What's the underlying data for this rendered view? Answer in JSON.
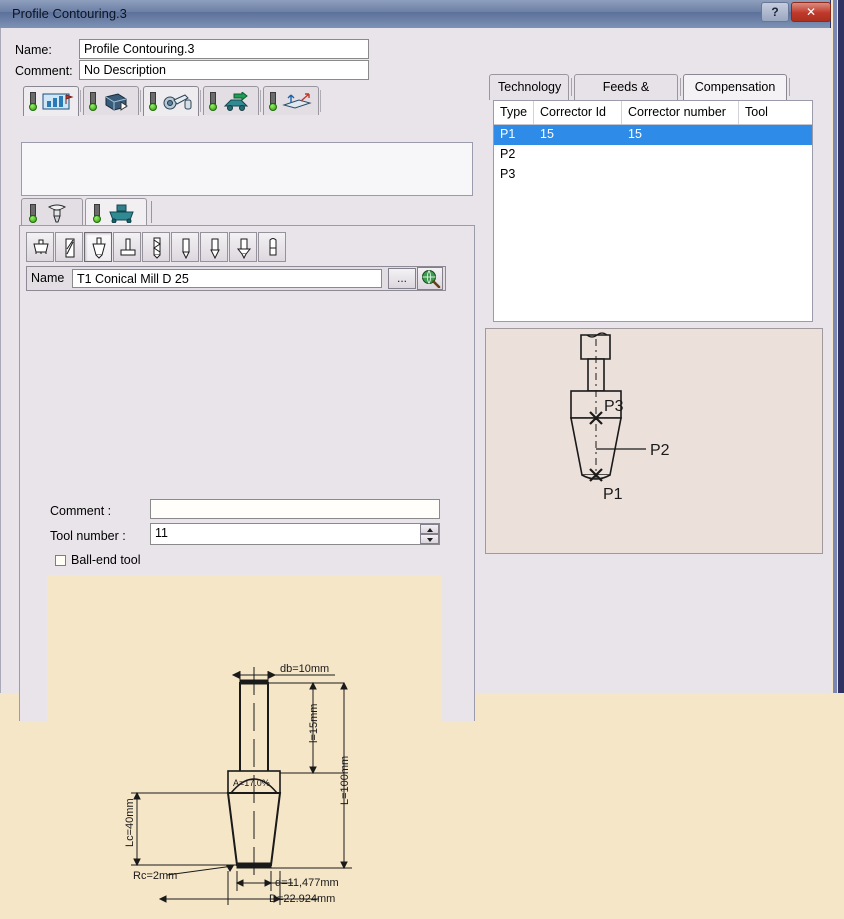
{
  "window": {
    "title": "Profile Contouring.3",
    "help_label": "?",
    "close_label": "✕"
  },
  "header": {
    "name_label": "Name:",
    "name_value": "Profile Contouring.3",
    "comment_label": "Comment:",
    "comment_value": "No Description"
  },
  "strategy_tabs": [
    {
      "name": "strategy",
      "icon": "strategy-icon",
      "selected": false
    },
    {
      "name": "geometry",
      "icon": "geometry-icon",
      "selected": false
    },
    {
      "name": "tool",
      "icon": "tool-icon",
      "selected": true
    },
    {
      "name": "feeds-speeds",
      "icon": "feeds-speeds-icon",
      "selected": false
    },
    {
      "name": "macros",
      "icon": "macros-icon",
      "selected": false
    }
  ],
  "sub_tabs": [
    {
      "name": "tool-definition",
      "icon": "tool-bit-icon",
      "selected": false
    },
    {
      "name": "tool-assembly",
      "icon": "tool-holder-icon",
      "selected": true
    }
  ],
  "tool_shapes": [
    {
      "name": "face-mill",
      "selected": false
    },
    {
      "name": "end-mill",
      "selected": false
    },
    {
      "name": "conical-mill",
      "selected": true
    },
    {
      "name": "t-slotter",
      "selected": false
    },
    {
      "name": "drill",
      "selected": false
    },
    {
      "name": "center-drill",
      "selected": false
    },
    {
      "name": "chamfer-tool",
      "selected": false
    },
    {
      "name": "countersink",
      "selected": false
    },
    {
      "name": "boring-bar",
      "selected": false
    }
  ],
  "tool_form": {
    "name_label": "Name",
    "name_value": "T1 Conical Mill D 25",
    "dots_label": "...",
    "browse_icon": "search-globe-icon",
    "comment_label": "Comment :",
    "comment_value": "",
    "comment_placeholder": "",
    "tool_number_label": "Tool number :",
    "tool_number_value": "11",
    "ball_end_label": "Ball-end tool",
    "ball_end_checked": false
  },
  "drawing": {
    "labels": {
      "db": "db=10mm",
      "l": "l=15mm",
      "L": "L=100mm",
      "Lc": "Lc=40mm",
      "Rc": "Rc=2mm",
      "d": "d=11,477mm",
      "D": "D=22.924mm",
      "A": "A=17.0%"
    }
  },
  "right_tabs": [
    {
      "label": "Technology",
      "selected": false
    },
    {
      "label": "Feeds & Speeds",
      "selected": false
    },
    {
      "label": "Compensation",
      "selected": true
    }
  ],
  "tab_nav": {
    "prev_label": "◀",
    "next_label": "▶"
  },
  "compensation_table": {
    "columns": [
      "Type",
      "Corrector Id",
      "Corrector number",
      "Tool diameter"
    ],
    "rows": [
      {
        "type": "P1",
        "corrector_id": "15",
        "corrector_number": "15",
        "tool_diameter": "",
        "selected": true
      },
      {
        "type": "P2",
        "corrector_id": "",
        "corrector_number": "",
        "tool_diameter": "",
        "selected": false
      },
      {
        "type": "P3",
        "corrector_id": "",
        "corrector_number": "",
        "tool_diameter": "",
        "selected": false
      }
    ]
  },
  "preview": {
    "points": [
      "P3",
      "P2",
      "P1"
    ]
  },
  "colors": {
    "selection": "#2e8ce8",
    "drawing_bg": "#f5e6c8",
    "preview_bg": "#ece0da",
    "title_bar": "#6d80a6",
    "close_button": "#c0392b"
  }
}
